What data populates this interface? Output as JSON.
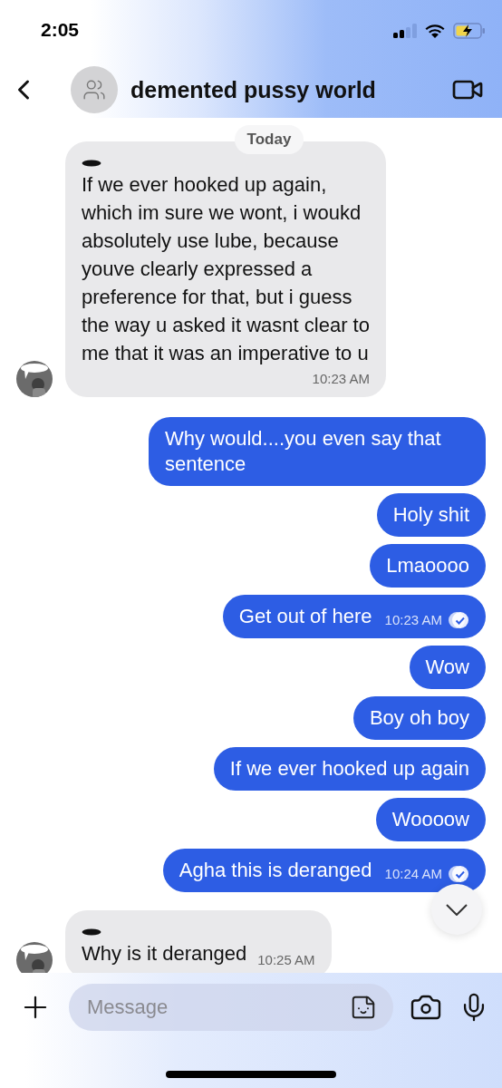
{
  "status_bar": {
    "time": "2:05"
  },
  "header": {
    "title": "demented pussy world"
  },
  "date_divider": "Today",
  "messages": [
    {
      "kind": "incoming",
      "text": "If we ever hooked up again,\nwhich im sure we wont, i woukd\nabsolutely use lube, because\nyouve clearly expressed a\npreference for that, but i guess\nthe way u asked it wasnt clear to\nme that it was an imperative to u",
      "time": "10:23 AM"
    },
    {
      "kind": "outgoing",
      "text": "Why would....you even say that sentence"
    },
    {
      "kind": "outgoing",
      "text": "Holy shit"
    },
    {
      "kind": "outgoing",
      "text": "Lmaoooo"
    },
    {
      "kind": "outgoing",
      "text": "Get out of here",
      "time": "10:23 AM",
      "read": true
    },
    {
      "kind": "outgoing",
      "text": "Wow"
    },
    {
      "kind": "outgoing",
      "text": "Boy oh boy"
    },
    {
      "kind": "outgoing",
      "text": "If we ever hooked up again"
    },
    {
      "kind": "outgoing",
      "text": "Woooow"
    },
    {
      "kind": "outgoing",
      "text": "Agha this is deranged",
      "time": "10:24 AM",
      "read": true
    },
    {
      "kind": "incoming_compact",
      "text": "Why is it deranged",
      "time": "10:25 AM"
    }
  ],
  "composer": {
    "placeholder": "Message"
  }
}
